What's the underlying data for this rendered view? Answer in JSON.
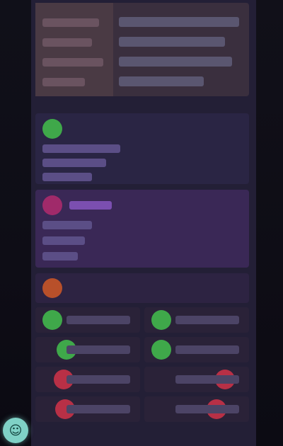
{
  "top": {
    "labels": [
      "",
      "",
      "",
      ""
    ],
    "values": [
      "",
      "",
      "",
      ""
    ]
  },
  "sections": [
    {
      "title": ""
    },
    {
      "title": ""
    },
    {
      "title": ""
    }
  ],
  "items": [
    {
      "label": "",
      "status": "ok"
    },
    {
      "label": "",
      "status": "ok"
    },
    {
      "label": "",
      "status": "ok"
    },
    {
      "label": "",
      "status": "ok"
    },
    {
      "label": "",
      "status": "error"
    },
    {
      "label": "",
      "status": "error"
    },
    {
      "label": "",
      "status": "error"
    },
    {
      "label": "",
      "status": "error"
    }
  ],
  "fab": {
    "icon": "chat-icon",
    "glyph": "☺"
  },
  "colors": {
    "ok": "#3fa84a",
    "error": "#b83046",
    "accent": "#7fd1c6"
  }
}
